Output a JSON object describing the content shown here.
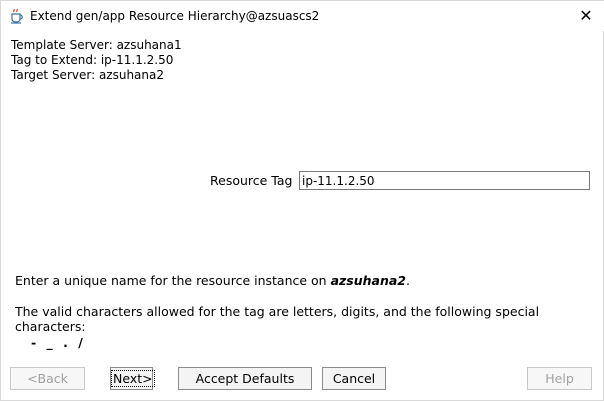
{
  "window": {
    "title": "Extend gen/app Resource Hierarchy@azsuascs2",
    "close_glyph": "✕"
  },
  "info": {
    "template_server": "Template Server: azsuhana1",
    "tag_to_extend": "Tag to Extend: ip-11.1.2.50",
    "target_server": "Target Server: azsuhana2"
  },
  "form": {
    "resource_tag_label": "Resource Tag",
    "resource_tag_value": "ip-11.1.2.50"
  },
  "messages": {
    "unique_prefix": "Enter a unique name for the resource instance on ",
    "unique_server": "azsuhana2",
    "unique_suffix": ".",
    "valid_chars": "The valid characters allowed for the tag are letters, digits, and the following special characters:",
    "special_chars": "- _ . /"
  },
  "buttons": {
    "back": "<Back",
    "next": "Next>",
    "accept_defaults": "Accept Defaults",
    "cancel": "Cancel",
    "help": "Help"
  },
  "icons": {
    "app": "java-cup-icon",
    "close": "close-icon"
  }
}
